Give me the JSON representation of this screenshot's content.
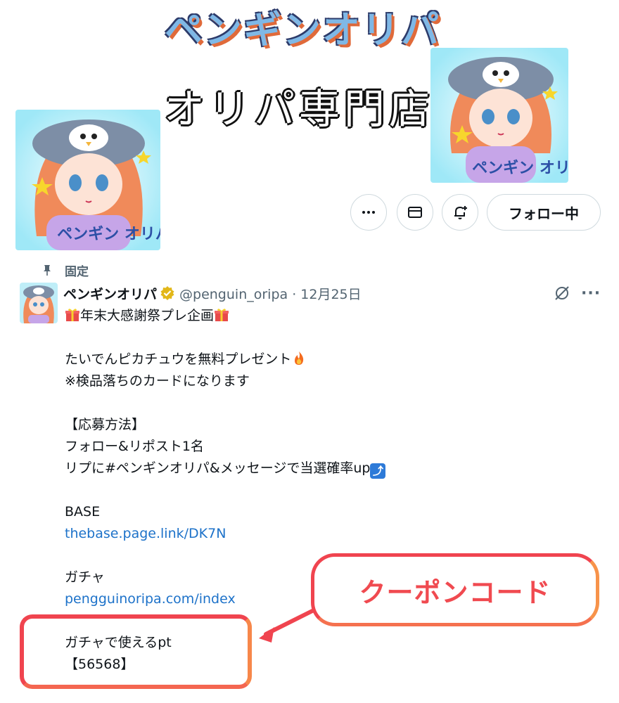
{
  "banner": {
    "title": "ペンギンオリパ",
    "subtitle": "オリパ専門店"
  },
  "art_labels": {
    "right": "ペンギン オリパ",
    "avatar": "ペンギン オリパ"
  },
  "profile_actions": {
    "more_icon": "more-dots-icon",
    "message_icon": "envelope-icon",
    "notify_icon": "bell-plus-icon",
    "follow_label": "フォロー中"
  },
  "pinned": {
    "icon": "pin-icon",
    "label": "固定"
  },
  "tweet": {
    "display_name": "ペンギンオリパ",
    "handle_date": "@penguin_oripa · 12月25日",
    "verified_color": "#e2b719",
    "lines": {
      "title": "年末大感謝祭プレ企画",
      "l1": "たいでんピカチュウを無料プレゼント",
      "l2": "※検品落ちのカードになります",
      "l3": "【応募方法】",
      "l4": "フォロー&リポスト1名",
      "l5": "リプに#ペンギンオリパ&メッセージで当選確率up",
      "base_label": "BASE",
      "base_link": "thebase.page.link/DK7N",
      "gacha_label": "ガチャ",
      "gacha_link": "pengguinoripa.com/index",
      "pt_label": "ガチャで使えるpt",
      "code": "【56568】"
    }
  },
  "annotation": {
    "callout_text": "クーポンコード",
    "accent": "#f0444f"
  }
}
